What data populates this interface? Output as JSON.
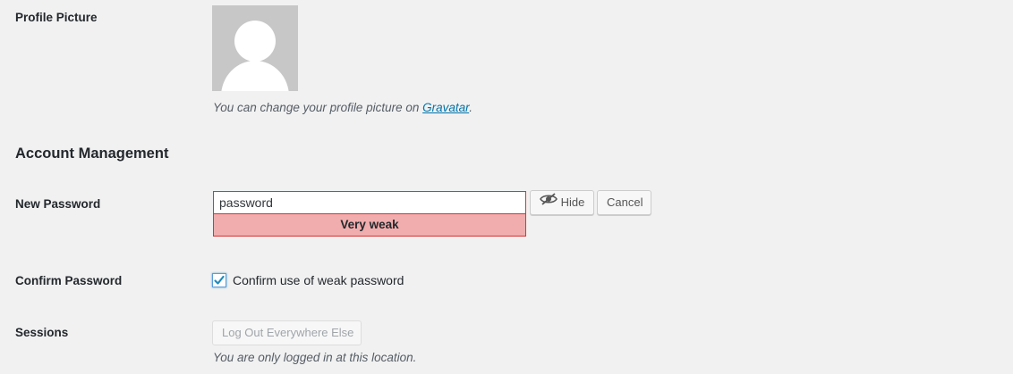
{
  "profile_picture": {
    "label": "Profile Picture",
    "desc_prefix": "You can change your profile picture on ",
    "link_text": "Gravatar",
    "desc_suffix": "."
  },
  "account_management": {
    "title": "Account Management"
  },
  "new_password": {
    "label": "New Password",
    "value": "password",
    "strength": "Very weak",
    "hide_label": "Hide",
    "cancel_label": "Cancel"
  },
  "confirm_password": {
    "label": "Confirm Password",
    "checkbox_label": "Confirm use of weak password",
    "checked": true
  },
  "sessions": {
    "label": "Sessions",
    "button_label": "Log Out Everywhere Else",
    "desc": "You are only logged in at this location."
  },
  "icons": {
    "avatar": "default-avatar-icon",
    "hide": "eye-slash-icon",
    "check": "checkmark-icon"
  },
  "colors": {
    "background": "#f1f1f1",
    "link": "#0073aa",
    "error_border": "#dc3232",
    "strength_bg": "#f1adad",
    "avatar_bg": "#c7c7c7"
  }
}
